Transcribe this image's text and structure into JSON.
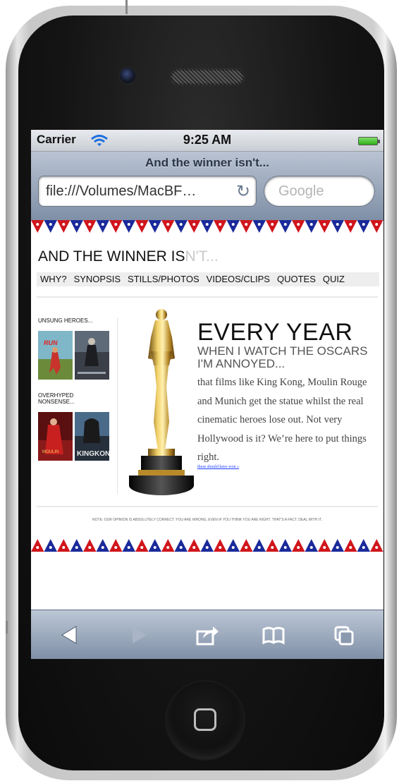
{
  "status_bar": {
    "carrier": "Carrier",
    "time": "9:25 AM"
  },
  "browser": {
    "page_title": "And the winner isn't...",
    "url": "file:///Volumes/MacBF…",
    "search_placeholder": "Google"
  },
  "site": {
    "title_main": "AND THE WINNER IS",
    "title_faded": "N'T...",
    "nav": [
      "WHY?",
      "SYNOPSIS",
      "STILLS/PHOTOS",
      "VIDEOS/CLIPS",
      "QUOTES",
      "QUIZ"
    ],
    "sidebar": {
      "unsung_heading": "UNSUNG HEROES...",
      "overhyped_heading_1": "OVERHYPED",
      "overhyped_heading_2": "NONSENSE..."
    },
    "hero": {
      "heading": "EVERY YEAR",
      "subheading": "WHEN I WATCH THE OSCARS I'M ANNOYED...",
      "body": "that films like King Kong, Moulin Rouge and Munich get the statue whilst the real cinematic heroes lose out. Not very Hollywood is it? We’re here to put things right.",
      "link": "these should have won »"
    },
    "footer_note": "NOTE: OUR OPINION IS ABSOLUTELY CORRECT. YOU ARE WRONG, EVEN IF YOU THINK YOU ARE RIGHT. THAT'S A FACT. DEAL WITH IT."
  },
  "colors": {
    "bunting_red": "#d0161c",
    "bunting_blue": "#1a2a9a",
    "chrome_blue_top": "#b9c3d2",
    "chrome_blue_bottom": "#7f8fa6"
  },
  "toolbar": {
    "icons": [
      "back-icon",
      "forward-icon",
      "share-icon",
      "bookmarks-icon",
      "tabs-icon"
    ]
  }
}
